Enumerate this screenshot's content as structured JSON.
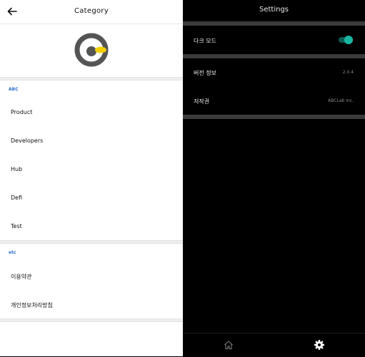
{
  "left": {
    "header": {
      "title": "Category",
      "back_icon": "arrow-left-icon"
    },
    "logo": {
      "name": "app-logo",
      "colors": [
        "#5a5a5a",
        "#f4d000"
      ]
    },
    "sections": [
      {
        "label": "ABC",
        "items": [
          "Product",
          "Developers",
          "Hub",
          "Defi",
          "Test"
        ]
      },
      {
        "label": "etc",
        "items": [
          "이용약관",
          "개인정보처리방침"
        ]
      }
    ]
  },
  "right": {
    "header": {
      "title": "Settings"
    },
    "rows": [
      {
        "label": "다크 모드",
        "value": "",
        "toggle_on": true
      },
      {
        "label": "버전 정보",
        "value": "2.0.4"
      },
      {
        "label": "저작권",
        "value": "ABCLab Inc."
      }
    ],
    "bottom_nav": [
      {
        "icon": "home-icon",
        "active": false
      },
      {
        "icon": "gear-icon",
        "active": true
      }
    ],
    "accent": "#18b7a2"
  }
}
